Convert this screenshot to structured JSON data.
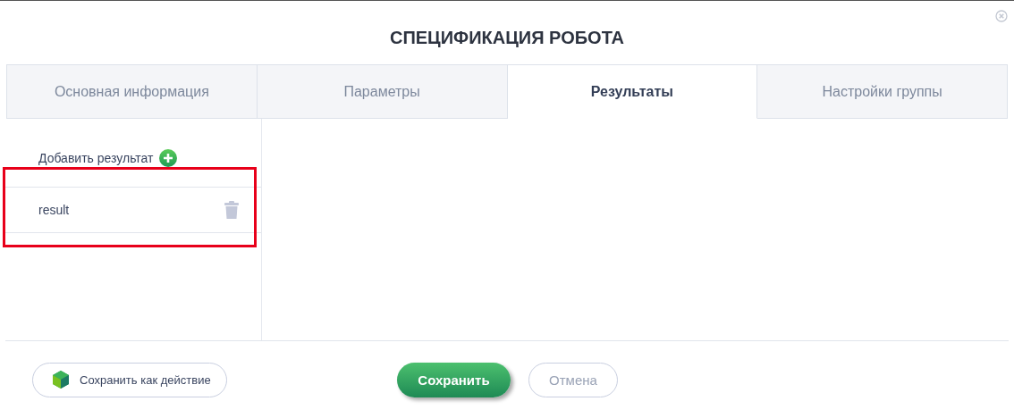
{
  "window": {
    "title": "СПЕЦИФИКАЦИЯ РОБОТА"
  },
  "tabs": [
    {
      "label": "Основная информация",
      "selected": false
    },
    {
      "label": "Параметры",
      "selected": false
    },
    {
      "label": "Результаты",
      "selected": true
    },
    {
      "label": "Настройки группы",
      "selected": false
    }
  ],
  "results": {
    "add_label": "Добавить результат",
    "items": [
      {
        "name": "result",
        "highlighted": true
      }
    ]
  },
  "buttons": [
    {
      "kind": "action",
      "label": "Сохранить как действие"
    },
    {
      "kind": "primary",
      "label": "Сохранить"
    },
    {
      "kind": "secondary",
      "label": "Отмена"
    }
  ]
}
